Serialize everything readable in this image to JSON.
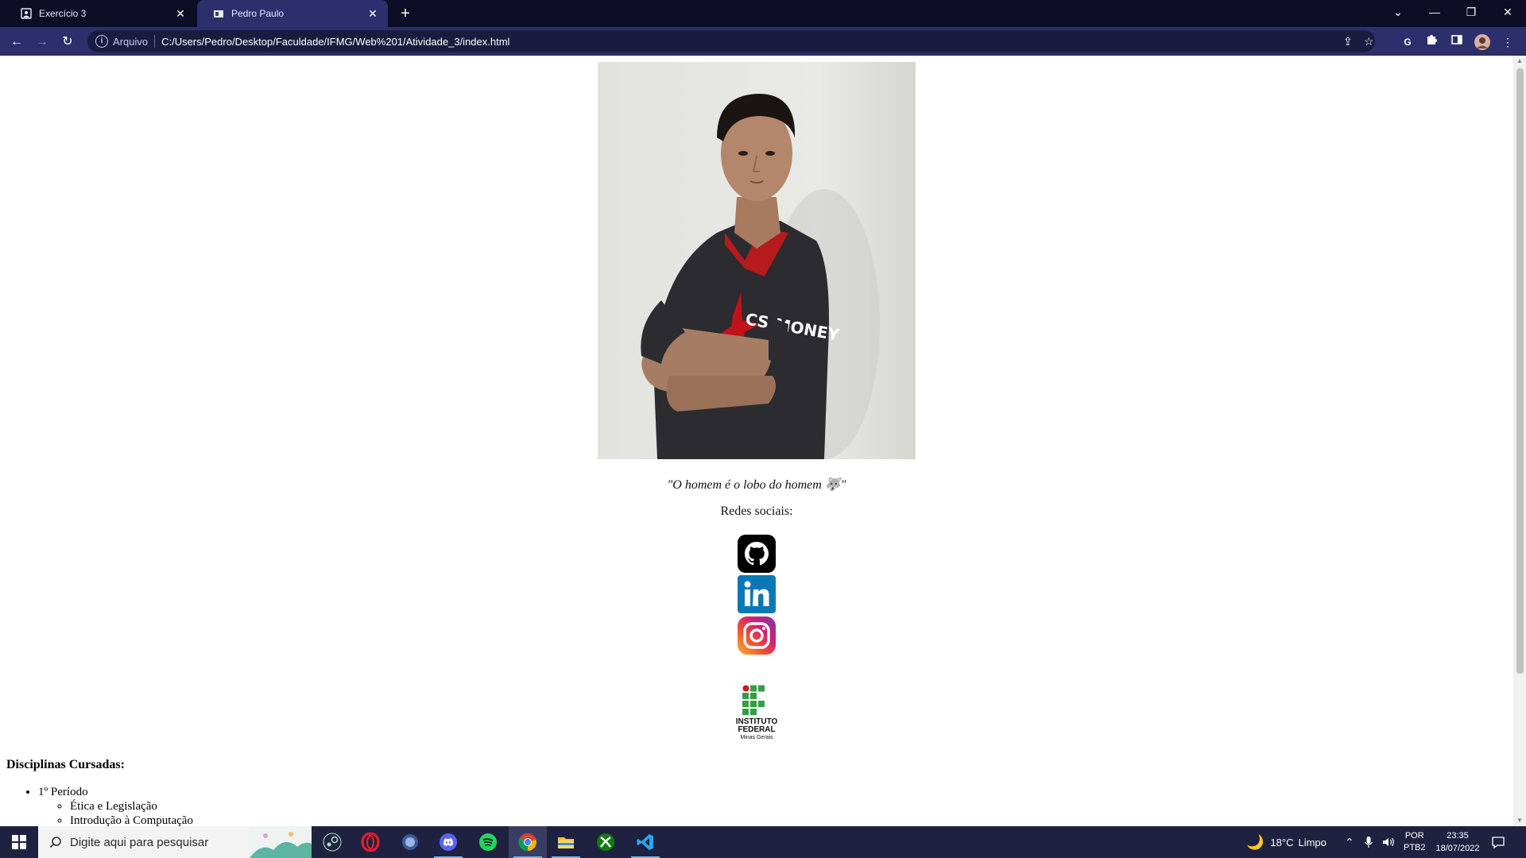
{
  "browser": {
    "tabs": [
      {
        "label": "Exercício 3",
        "icon": "image-favicon-icon",
        "active": false
      },
      {
        "label": "Pedro Paulo",
        "icon": "page-favicon-icon",
        "active": true
      }
    ],
    "address": {
      "scheme_label": "Arquivo",
      "url": "C:/Users/Pedro/Desktop/Faculdade/IFMG/Web%201/Atividade_3/index.html"
    }
  },
  "page": {
    "quote": "\"O homem é o lobo do homem 🐺\"",
    "social_title": "Redes sociais:",
    "social_links": [
      {
        "name": "GitHub",
        "icon": "github-icon"
      },
      {
        "name": "LinkedIn",
        "icon": "linkedin-icon"
      },
      {
        "name": "Instagram",
        "icon": "instagram-icon"
      }
    ],
    "institution_logo": {
      "line1": "INSTITUTO",
      "line2": "FEDERAL",
      "line3": "Minas Gerais"
    },
    "jersey_text": "CS:MONEY",
    "disciplines_heading": "Disciplinas Cursadas:",
    "periods": [
      {
        "label": "1º Período",
        "subjects": [
          "Ética e Legislação",
          "Introdução à Computação"
        ]
      }
    ]
  },
  "taskbar": {
    "search_placeholder": "Digite aqui para pesquisar",
    "apps": [
      "steam-icon",
      "opera-icon",
      "app-icon",
      "discord-icon",
      "spotify-icon",
      "chrome-icon",
      "file-explorer-icon",
      "xbox-icon",
      "vscode-icon"
    ],
    "weather": {
      "temp": "18°C",
      "condition": "Limpo"
    },
    "language": {
      "line1": "POR",
      "line2": "PTB2"
    },
    "clock": {
      "time": "23:35",
      "date": "18/07/2022"
    }
  },
  "colors": {
    "tabstrip_bg": "#0b0d24",
    "toolbar_bg": "#2c2f6b",
    "taskbar_bg": "#1f2140",
    "ifmg_green": "#32a041",
    "ifmg_red": "#c8191e"
  }
}
